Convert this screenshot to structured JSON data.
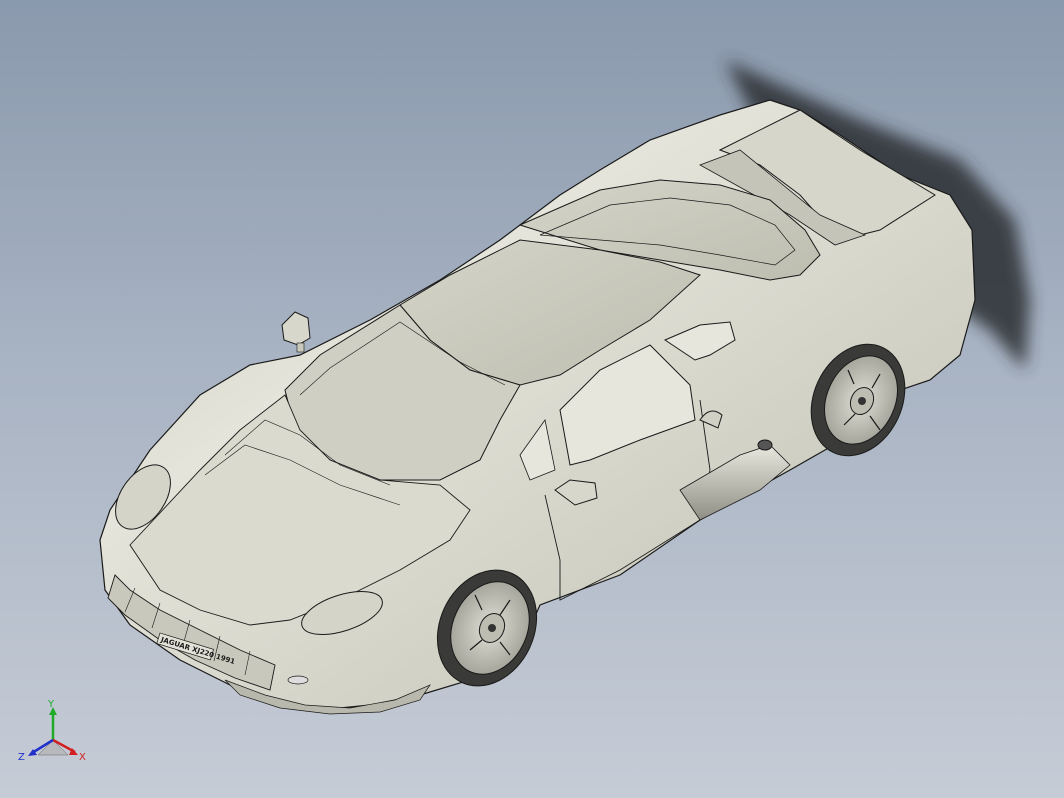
{
  "viewport": {
    "background_top": "#8a99ad",
    "background_bottom": "#c6ccd6"
  },
  "model": {
    "body_color": "#d9d9cd",
    "edge_color": "#1a1a1a",
    "shadow_color": "#2a2d33",
    "plate_text": "JAGUAR XJ220 1991"
  },
  "triad": {
    "x_label": "X",
    "y_label": "Y",
    "z_label": "Z",
    "x_color": "#d22020",
    "y_color": "#1faa2a",
    "z_color": "#2030c8"
  }
}
